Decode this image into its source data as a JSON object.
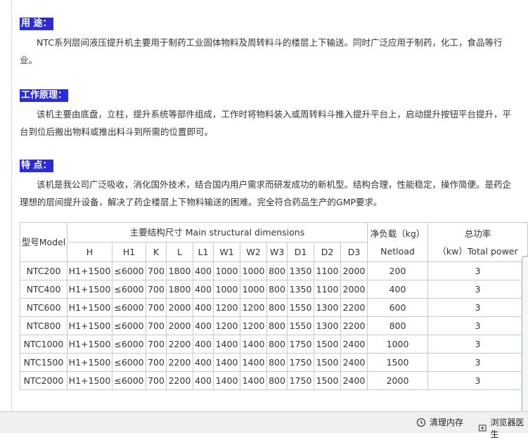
{
  "sections": [
    {
      "heading": "用    途：",
      "lines": [
        "NTC系列层间液压提升机主要用于制药工业固体物料及周转料斗的楼层上下输送。同时广泛应用于制药，化工，食品等行",
        "业。"
      ]
    },
    {
      "heading": "工作原理：",
      "lines": [
        "该机主要由底盘，立柱，提升系统等部件组成，工作时将物料装入或周转料斗推入提升平台上，启动提升按钮平台提升，平",
        "台到位后搬出物料或推出料斗到所需的位置即可。"
      ]
    },
    {
      "heading": "特    点：",
      "lines": [
        "该机是我公司广泛吸收，消化国外技术，结合国内用户需求而研发成功的新机型。结构合理，性能稳定，操作简便。是药企",
        "理想的层间提升设备，解决了药企楼层上下物料输送的困难。完全符合药品生产的GMP要求。"
      ]
    }
  ],
  "table": {
    "model_header": "型号Model",
    "dimensions_header": "主要结构尺寸 Main structural dimensions",
    "netload_header_cn": "净负载（kg）",
    "netload_header_en": "Netload",
    "power_header_cn": "总功率",
    "power_header_en": "（kw）Total power",
    "dim_columns": [
      "H",
      "H1",
      "K",
      "L",
      "L1",
      "W1",
      "W2",
      "W3",
      "D1",
      "D2",
      "D3"
    ],
    "rows": [
      [
        "NTC200",
        "H1+1500",
        "≤6000",
        "700",
        "1800",
        "400",
        "1000",
        "1000",
        "800",
        "1350",
        "1100",
        "2000",
        "200",
        "3"
      ],
      [
        "NTC400",
        "H1+1500",
        "≤6000",
        "700",
        "1800",
        "400",
        "1000",
        "1000",
        "800",
        "1350",
        "1100",
        "2000",
        "400",
        "3"
      ],
      [
        "NTC600",
        "H1+1500",
        "≤6000",
        "700",
        "2000",
        "400",
        "1200",
        "1200",
        "800",
        "1550",
        "1300",
        "2200",
        "600",
        "3"
      ],
      [
        "NTC800",
        "H1+1500",
        "≤6000",
        "700",
        "2000",
        "400",
        "1200",
        "1200",
        "800",
        "1550",
        "1300",
        "2200",
        "800",
        "3"
      ],
      [
        "NTC1000",
        "H1+1500",
        "≤6000",
        "700",
        "2200",
        "400",
        "1400",
        "1400",
        "800",
        "1750",
        "1500",
        "2400",
        "1000",
        "3"
      ],
      [
        "NTC1500",
        "H1+1500",
        "≤6000",
        "700",
        "2200",
        "400",
        "1400",
        "1400",
        "800",
        "1750",
        "1500",
        "2400",
        "1500",
        "3"
      ],
      [
        "NTC2000",
        "H1+1500",
        "≤6000",
        "700",
        "2200",
        "400",
        "1400",
        "1400",
        "800",
        "1750",
        "1500",
        "2400",
        "2000",
        "3"
      ]
    ]
  },
  "statusbar": {
    "clear_memory": "清理内存",
    "browser_doctor": "浏览器医生"
  },
  "colors": {
    "heading_bg": "#2b2bd8",
    "table_border": "#c8c8c8"
  }
}
